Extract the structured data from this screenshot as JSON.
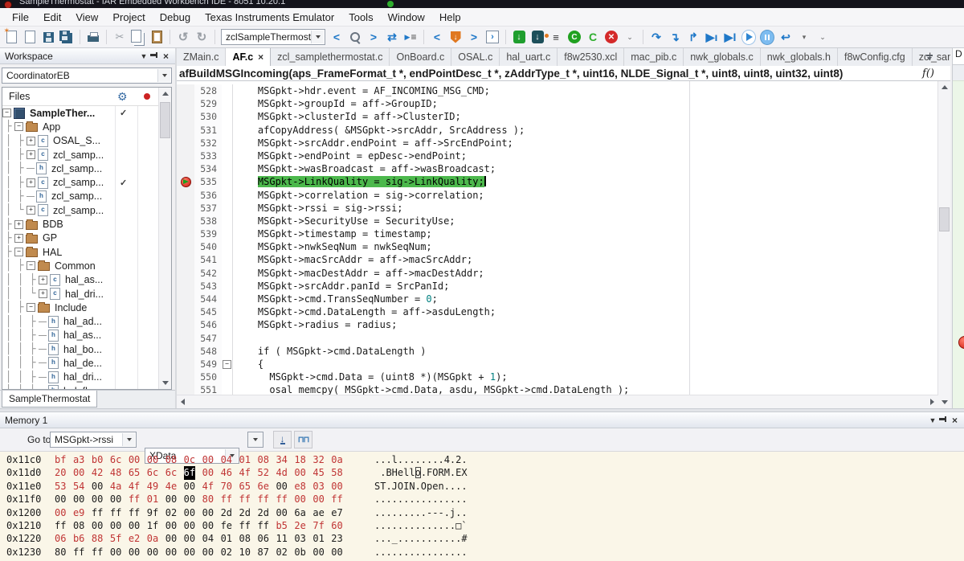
{
  "title_bar": {
    "title": "SampleThermostat - IAR Embedded Workbench IDE - 8051 10.20.1"
  },
  "menu": {
    "items": [
      "File",
      "Edit",
      "View",
      "Project",
      "Debug",
      "Texas Instruments Emulator",
      "Tools",
      "Window",
      "Help"
    ]
  },
  "toolbar": {
    "find_value": "zclSampleThermost"
  },
  "workspace": {
    "title": "Workspace",
    "config": "CoordinatorEB",
    "files_header": "Files",
    "bottom_tab": "SampleThermostat",
    "tree": [
      {
        "guide": "",
        "box": "-",
        "icon": "project",
        "label": "SampleTher...",
        "bold": true,
        "check": true
      },
      {
        "guide": "├",
        "box": "-",
        "icon": "folder",
        "label": "App"
      },
      {
        "guide": "│├",
        "box": "+",
        "icon": "c",
        "label": "OSAL_S..."
      },
      {
        "guide": "│├",
        "box": "+",
        "icon": "c",
        "label": "zcl_samp..."
      },
      {
        "guide": "│├",
        "box": "~",
        "icon": "h",
        "label": "zcl_samp..."
      },
      {
        "guide": "│├",
        "box": "+",
        "icon": "c",
        "label": "zcl_samp...",
        "check": true
      },
      {
        "guide": "│├",
        "box": "~",
        "icon": "h",
        "label": "zcl_samp..."
      },
      {
        "guide": "│└",
        "box": "+",
        "icon": "c",
        "label": "zcl_samp..."
      },
      {
        "guide": "├",
        "box": "+",
        "icon": "folder",
        "label": "BDB"
      },
      {
        "guide": "├",
        "box": "+",
        "icon": "folder",
        "label": "GP"
      },
      {
        "guide": "├",
        "box": "-",
        "icon": "folder",
        "label": "HAL"
      },
      {
        "guide": "│├",
        "box": "-",
        "icon": "folder",
        "label": "Common"
      },
      {
        "guide": "││├",
        "box": "+",
        "icon": "c",
        "label": "hal_as..."
      },
      {
        "guide": "││└",
        "box": "+",
        "icon": "c",
        "label": "hal_dri..."
      },
      {
        "guide": "│├",
        "box": "-",
        "icon": "folder",
        "label": "Include"
      },
      {
        "guide": "││├",
        "box": "~",
        "icon": "h",
        "label": "hal_ad..."
      },
      {
        "guide": "││├",
        "box": "~",
        "icon": "h",
        "label": "hal_as..."
      },
      {
        "guide": "││├",
        "box": "~",
        "icon": "h",
        "label": "hal_bo..."
      },
      {
        "guide": "││├",
        "box": "~",
        "icon": "h",
        "label": "hal_de..."
      },
      {
        "guide": "││├",
        "box": "~",
        "icon": "h",
        "label": "hal_dri..."
      },
      {
        "guide": "││├",
        "box": "~",
        "icon": "h",
        "label": "hal_fla..."
      }
    ]
  },
  "editor": {
    "tabs": [
      {
        "label": "ZMain.c"
      },
      {
        "label": "AF.c",
        "active": true
      },
      {
        "label": "zcl_samplethermostat.c"
      },
      {
        "label": "OnBoard.c"
      },
      {
        "label": "OSAL.c"
      },
      {
        "label": "hal_uart.c"
      },
      {
        "label": "f8w2530.xcl"
      },
      {
        "label": "mac_pib.c"
      },
      {
        "label": "nwk_globals.c"
      },
      {
        "label": "nwk_globals.h"
      },
      {
        "label": "f8wConfig.cfg"
      },
      {
        "label": "zcl_sampleapps_ui.c"
      }
    ],
    "signature": "afBuildMSGIncoming(aps_FrameFormat_t *, endPointDesc_t *, zAddrType_t *, uint16, NLDE_Signal_t *, uint8, uint8, uint32, uint8)",
    "fn_icon": "f()",
    "side_tab": "D",
    "code": [
      {
        "n": 528,
        "t": "    MSGpkt->hdr.event = AF_INCOMING_MSG_CMD;"
      },
      {
        "n": 529,
        "t": "    MSGpkt->groupId = aff->GroupID;"
      },
      {
        "n": 530,
        "t": "    MSGpkt->clusterId = aff->ClusterID;"
      },
      {
        "n": 531,
        "t": "    afCopyAddress( &MSGpkt->srcAddr, SrcAddress );"
      },
      {
        "n": 532,
        "t": "    MSGpkt->srcAddr.endPoint = aff->SrcEndPoint;"
      },
      {
        "n": 533,
        "t": "    MSGpkt->endPoint = epDesc->endPoint;"
      },
      {
        "n": 534,
        "t": "    MSGpkt->wasBroadcast = aff->wasBroadcast;"
      },
      {
        "n": 535,
        "pre": "    ",
        "hl": "MSGpkt->LinkQuality = sig->LinkQuality;",
        "bp": true,
        "cursor": true
      },
      {
        "n": 536,
        "t": "    MSGpkt->correlation = sig->correlation;"
      },
      {
        "n": 537,
        "t": "    MSGpkt->rssi = sig->rssi;"
      },
      {
        "n": 538,
        "t": "    MSGpkt->SecurityUse = SecurityUse;"
      },
      {
        "n": 539,
        "t": "    MSGpkt->timestamp = timestamp;"
      },
      {
        "n": 540,
        "t": "    MSGpkt->nwkSeqNum = nwkSeqNum;"
      },
      {
        "n": 541,
        "t": "    MSGpkt->macSrcAddr = aff->macSrcAddr;"
      },
      {
        "n": 542,
        "t": "    MSGpkt->macDestAddr = aff->macDestAddr;"
      },
      {
        "n": 543,
        "t": "    MSGpkt->srcAddr.panId = SrcPanId;"
      },
      {
        "n": 544,
        "segs": [
          {
            "t": "    MSGpkt->cmd.TransSeqNumber = "
          },
          {
            "t": "0",
            "c": "num"
          },
          {
            "t": ";"
          }
        ]
      },
      {
        "n": 545,
        "t": "    MSGpkt->cmd.DataLength = aff->asduLength;"
      },
      {
        "n": 546,
        "t": "    MSGpkt->radius = radius;"
      },
      {
        "n": 547,
        "t": ""
      },
      {
        "n": 548,
        "t": "    if ( MSGpkt->cmd.DataLength )"
      },
      {
        "n": 549,
        "t": "    {",
        "fold": true
      },
      {
        "n": 550,
        "segs": [
          {
            "t": "      MSGpkt->cmd.Data = (uint8 *)(MSGpkt + "
          },
          {
            "t": "1",
            "c": "num"
          },
          {
            "t": ");"
          }
        ]
      },
      {
        "n": 551,
        "t": "      osal_memcpy( MSGpkt->cmd.Data, asdu, MSGpkt->cmd.DataLength );"
      }
    ]
  },
  "memory": {
    "title": "Memory 1",
    "goto_label": "Go to",
    "goto_value": "MSGpkt->rssi",
    "zone_value": "XData",
    "rows": [
      {
        "addr": "0x11c0",
        "bytes": [
          "bf",
          "a3",
          "b0",
          "6c",
          "00",
          "00",
          "08",
          "0c",
          "00",
          "04",
          "01",
          "08",
          "34",
          "18",
          "32",
          "0a"
        ],
        "flags": "rrrrrrrrrrrrrrrr",
        "ascii": "...l........4.2.",
        "cursor": -1
      },
      {
        "addr": "0x11d0",
        "bytes": [
          "20",
          "00",
          "42",
          "48",
          "65",
          "6c",
          "6c",
          "6f",
          "00",
          "46",
          "4f",
          "52",
          "4d",
          "00",
          "45",
          "58"
        ],
        "flags": "rrrrrrrsrrrrrrrr",
        "ascii": " .BHello.FORM.EX",
        "cursor": 7
      },
      {
        "addr": "0x11e0",
        "bytes": [
          "53",
          "54",
          "00",
          "4a",
          "4f",
          "49",
          "4e",
          "00",
          "4f",
          "70",
          "65",
          "6e",
          "00",
          "e8",
          "03",
          "00"
        ],
        "flags": "rrkrrrrkrrrrkrrr",
        "ascii": "ST.JOIN.Open....",
        "cursor": -1
      },
      {
        "addr": "0x11f0",
        "bytes": [
          "00",
          "00",
          "00",
          "00",
          "ff",
          "01",
          "00",
          "00",
          "80",
          "ff",
          "ff",
          "ff",
          "ff",
          "00",
          "00",
          "ff"
        ],
        "flags": "kkkkrrkkrrrrrrrr",
        "ascii": "................",
        "cursor": -1
      },
      {
        "addr": "0x1200",
        "bytes": [
          "00",
          "e9",
          "ff",
          "ff",
          "ff",
          "9f",
          "02",
          "00",
          "00",
          "2d",
          "2d",
          "2d",
          "00",
          "6a",
          "ae",
          "e7"
        ],
        "flags": "rrkkkkkkkkkkkkkk",
        "ascii": ".........---.j..",
        "cursor": -1
      },
      {
        "addr": "0x1210",
        "bytes": [
          "ff",
          "08",
          "00",
          "00",
          "00",
          "1f",
          "00",
          "00",
          "00",
          "fe",
          "ff",
          "ff",
          "b5",
          "2e",
          "7f",
          "60"
        ],
        "flags": "kkkkkkkkkkkkrrrr",
        "ascii": "..............□`",
        "cursor": -1
      },
      {
        "addr": "0x1220",
        "bytes": [
          "06",
          "b6",
          "88",
          "5f",
          "e2",
          "0a",
          "00",
          "00",
          "04",
          "01",
          "08",
          "06",
          "11",
          "03",
          "01",
          "23"
        ],
        "flags": "rrrrrrkkkkkkkkkk",
        "ascii": "..._...........#",
        "cursor": -1
      },
      {
        "addr": "0x1230",
        "bytes": [
          "80",
          "ff",
          "ff",
          "00",
          "00",
          "00",
          "00",
          "00",
          "00",
          "02",
          "10",
          "87",
          "02",
          "0b",
          "00",
          "00"
        ],
        "flags": "kkkkkkkkkkkkkkkk",
        "ascii": "................",
        "cursor": -1
      }
    ]
  },
  "colors": {
    "highlight_green": "#4cb84c",
    "changed_red": "#c03434",
    "memory_bg": "#faf6e8"
  }
}
